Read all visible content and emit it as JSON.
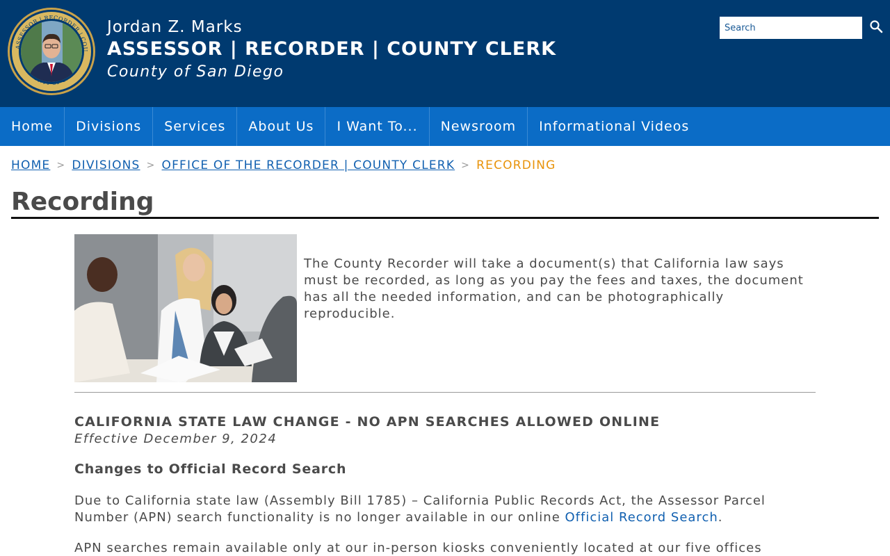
{
  "header": {
    "official_name": "Jordan Z. Marks",
    "office_title": "ASSESSOR | RECORDER | COUNTY CLERK",
    "county": "County of San Diego",
    "seal_icon": "county-seal-portrait",
    "search_placeholder": "Search",
    "search_icon": "search-icon"
  },
  "nav": {
    "items": [
      {
        "label": "Home"
      },
      {
        "label": "Divisions"
      },
      {
        "label": "Services"
      },
      {
        "label": "About Us"
      },
      {
        "label": "I Want To..."
      },
      {
        "label": "Newsroom"
      },
      {
        "label": "Informational Videos"
      }
    ]
  },
  "breadcrumb": {
    "items": [
      {
        "label": "HOME"
      },
      {
        "label": "DIVISIONS"
      },
      {
        "label": "OFFICE OF THE RECORDER | COUNTY CLERK"
      }
    ],
    "separator": ">",
    "current": "RECORDING"
  },
  "page": {
    "title": "Recording",
    "intro": "The County Recorder will take a document(s) that California law says must be recorded, as long as you pay the fees and taxes, the document has all the needed information, and can be photographically reproducible.",
    "notice_heading": "CALIFORNIA STATE LAW CHANGE - NO APN SEARCHES ALLOWED ONLINE",
    "notice_date": "Effective December 9, 2024",
    "sub_heading": "Changes to Official Record Search",
    "para1_text": "Due to California state law (Assembly Bill 1785) – California Public Records Act, the Assessor Parcel Number (APN) search functionality is no longer available in our online ",
    "para1_link": "Official Record Search",
    "para1_end": ".",
    "para2_text": "APN searches remain available only at our in-person kiosks conveniently located at our five offices"
  },
  "colors": {
    "header_bg": "#003a70",
    "nav_bg": "#0b6cc6",
    "link": "#1160b0",
    "breadcrumb_current": "#e8930a"
  }
}
